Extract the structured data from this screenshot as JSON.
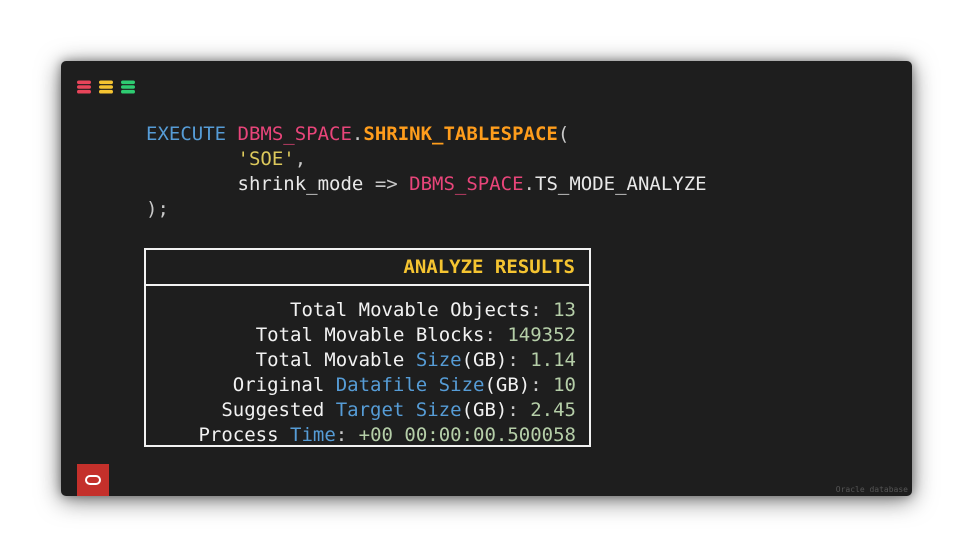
{
  "window_dots": [
    {
      "name": "red-db-icon",
      "color": "#e8455a"
    },
    {
      "name": "yellow-db-icon",
      "color": "#f5c431"
    },
    {
      "name": "green-db-icon",
      "color": "#2ecc71"
    }
  ],
  "code": {
    "keyword": "EXECUTE",
    "package": "DBMS_SPACE",
    "dot": ".",
    "procedure": "SHRINK_TABLESPACE",
    "open_paren": "(",
    "arg1": "'SOE'",
    "comma": ",",
    "param_name": "shrink_mode",
    "arrow": "=>",
    "param_pkg": "DBMS_SPACE",
    "param_dot": ".",
    "param_value": "TS_MODE_ANALYZE",
    "close": ");"
  },
  "results": {
    "title": "ANALYZE RESULTS",
    "rows": [
      {
        "parts": [
          {
            "t": "Total Movable Objects",
            "c": "text"
          },
          {
            "t": ": ",
            "c": "colon"
          },
          {
            "t": "13",
            "c": "num"
          }
        ]
      },
      {
        "parts": [
          {
            "t": "Total Movable Blocks",
            "c": "text"
          },
          {
            "t": ": ",
            "c": "colon"
          },
          {
            "t": "149352",
            "c": "num"
          }
        ]
      },
      {
        "parts": [
          {
            "t": "Total Movable ",
            "c": "text"
          },
          {
            "t": "Size",
            "c": "kw"
          },
          {
            "t": "(GB)",
            "c": "text"
          },
          {
            "t": ": ",
            "c": "colon"
          },
          {
            "t": "1.14",
            "c": "num"
          }
        ]
      },
      {
        "parts": [
          {
            "t": "Original ",
            "c": "text"
          },
          {
            "t": "Datafile Size",
            "c": "kw"
          },
          {
            "t": "(GB)",
            "c": "text"
          },
          {
            "t": ": ",
            "c": "colon"
          },
          {
            "t": "10",
            "c": "num"
          }
        ]
      },
      {
        "parts": [
          {
            "t": "Suggested ",
            "c": "text"
          },
          {
            "t": "Target Size",
            "c": "kw"
          },
          {
            "t": "(GB)",
            "c": "text"
          },
          {
            "t": ": ",
            "c": "colon"
          },
          {
            "t": "2.45",
            "c": "num"
          }
        ]
      },
      {
        "parts": [
          {
            "t": "Process ",
            "c": "text"
          },
          {
            "t": "Time",
            "c": "kw"
          },
          {
            "t": ": ",
            "c": "colon"
          },
          {
            "t": "+00 00:00:00.500058",
            "c": "num"
          }
        ]
      }
    ]
  },
  "footer": {
    "logo_icon": "oracle-logo-icon",
    "label": "Oracle database"
  }
}
